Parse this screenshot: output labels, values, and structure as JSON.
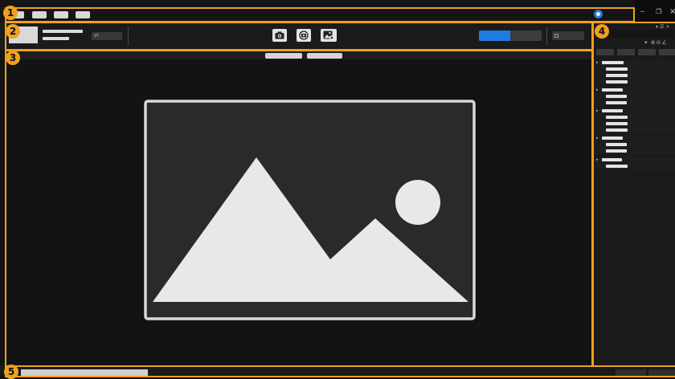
{
  "regions": {
    "r1": "1",
    "r2": "2",
    "r3": "3",
    "r4": "4",
    "r5": "5"
  },
  "titlebar": {
    "menu_items": [
      "",
      "",
      "",
      ""
    ],
    "window_controls": {
      "minimize": "–",
      "restore": "❐",
      "close": "×"
    }
  },
  "toolbar": {
    "actions": [
      {
        "icon": "camera-icon"
      },
      {
        "icon": "sync-camera-icon"
      },
      {
        "icon": "image-settings-icon"
      }
    ],
    "progress_fraction": 0.5,
    "accent": "#1e7be0"
  },
  "viewport": {
    "tabs": [
      "",
      ""
    ],
    "placeholder_icon": "image-placeholder-icon"
  },
  "sidepanel": {
    "header_icons": [
      "expand-icon",
      "list-icon",
      "close-icon",
      "add-icon",
      "remove-icon",
      "edit-icon"
    ]
  },
  "colors": {
    "highlight": "#f0a020",
    "accent_blue": "#1e7be0"
  }
}
